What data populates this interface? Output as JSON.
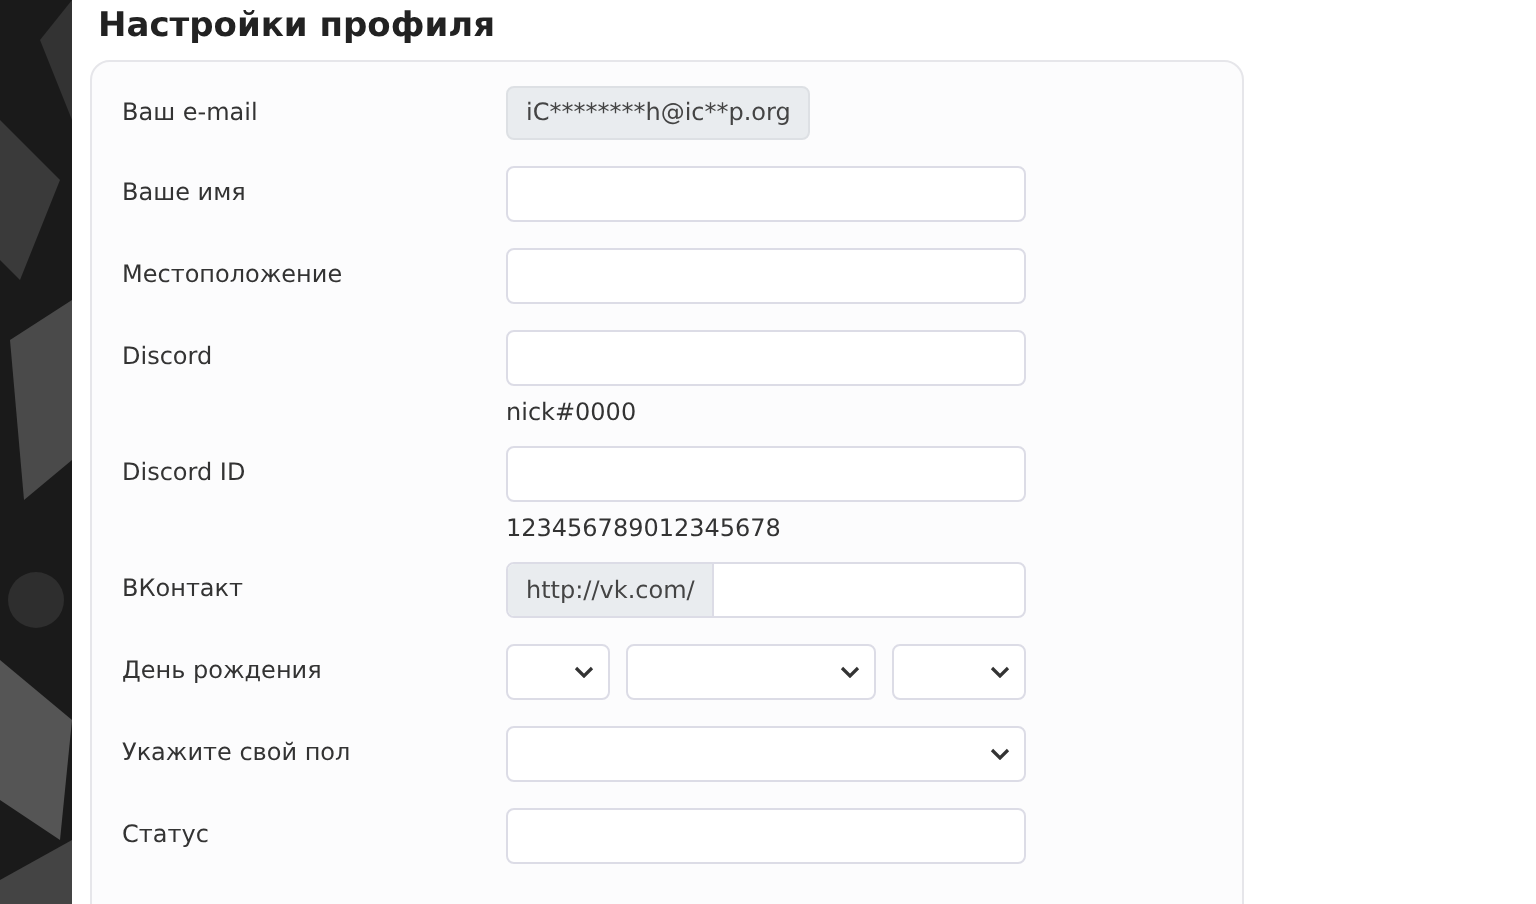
{
  "page": {
    "title": "Настройки профиля"
  },
  "fields": [
    {
      "label": "Ваш e-mail",
      "kind": "readonly",
      "value": "iC********h@ic**p.org"
    },
    {
      "label": "Ваше имя",
      "kind": "input"
    },
    {
      "label": "Местоположение",
      "kind": "input"
    },
    {
      "label": "Discord",
      "kind": "input",
      "hint": "nick#0000"
    },
    {
      "label": "Discord ID",
      "kind": "input",
      "hint": "123456789012345678"
    },
    {
      "label": "ВКонтакт",
      "kind": "prefix",
      "prefix": "http://vk.com/"
    },
    {
      "label": "День рождения",
      "kind": "date"
    },
    {
      "label": "Укажите свой пол",
      "kind": "select"
    },
    {
      "label": "Статус",
      "kind": "input"
    }
  ]
}
